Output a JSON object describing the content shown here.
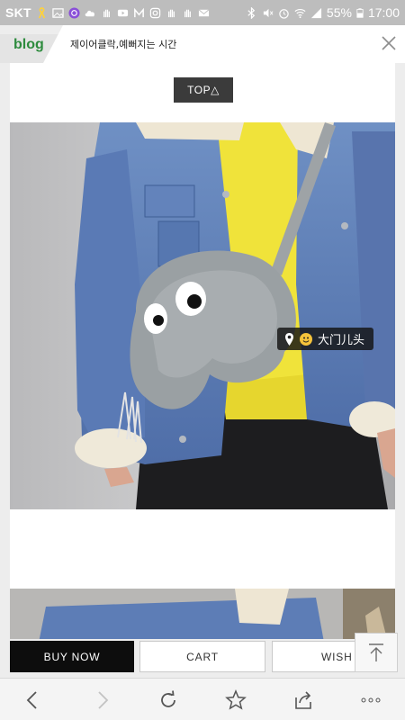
{
  "status_bar": {
    "carrier": "SKT",
    "battery": "55%",
    "time": "17:00"
  },
  "header": {
    "logo": "blog",
    "title": "제이어클락,예뻐지는 시간"
  },
  "content": {
    "top_button": "TOP△",
    "location_tag": "大门儿头"
  },
  "actions": {
    "buy_now": "BUY NOW",
    "cart": "CART",
    "wish": "WISH"
  },
  "colors": {
    "accent_green": "#2e8b3e",
    "buy_button": "#0d0d0d",
    "status_bar": "#bdbdbd"
  },
  "icons": {
    "browser_back": "chevron-left-icon",
    "browser_forward": "chevron-right-icon",
    "reload": "reload-icon",
    "bookmark": "star-icon",
    "share": "share-icon",
    "menu": "more-dots-icon",
    "scroll_top": "arrow-up-to-line-icon"
  }
}
